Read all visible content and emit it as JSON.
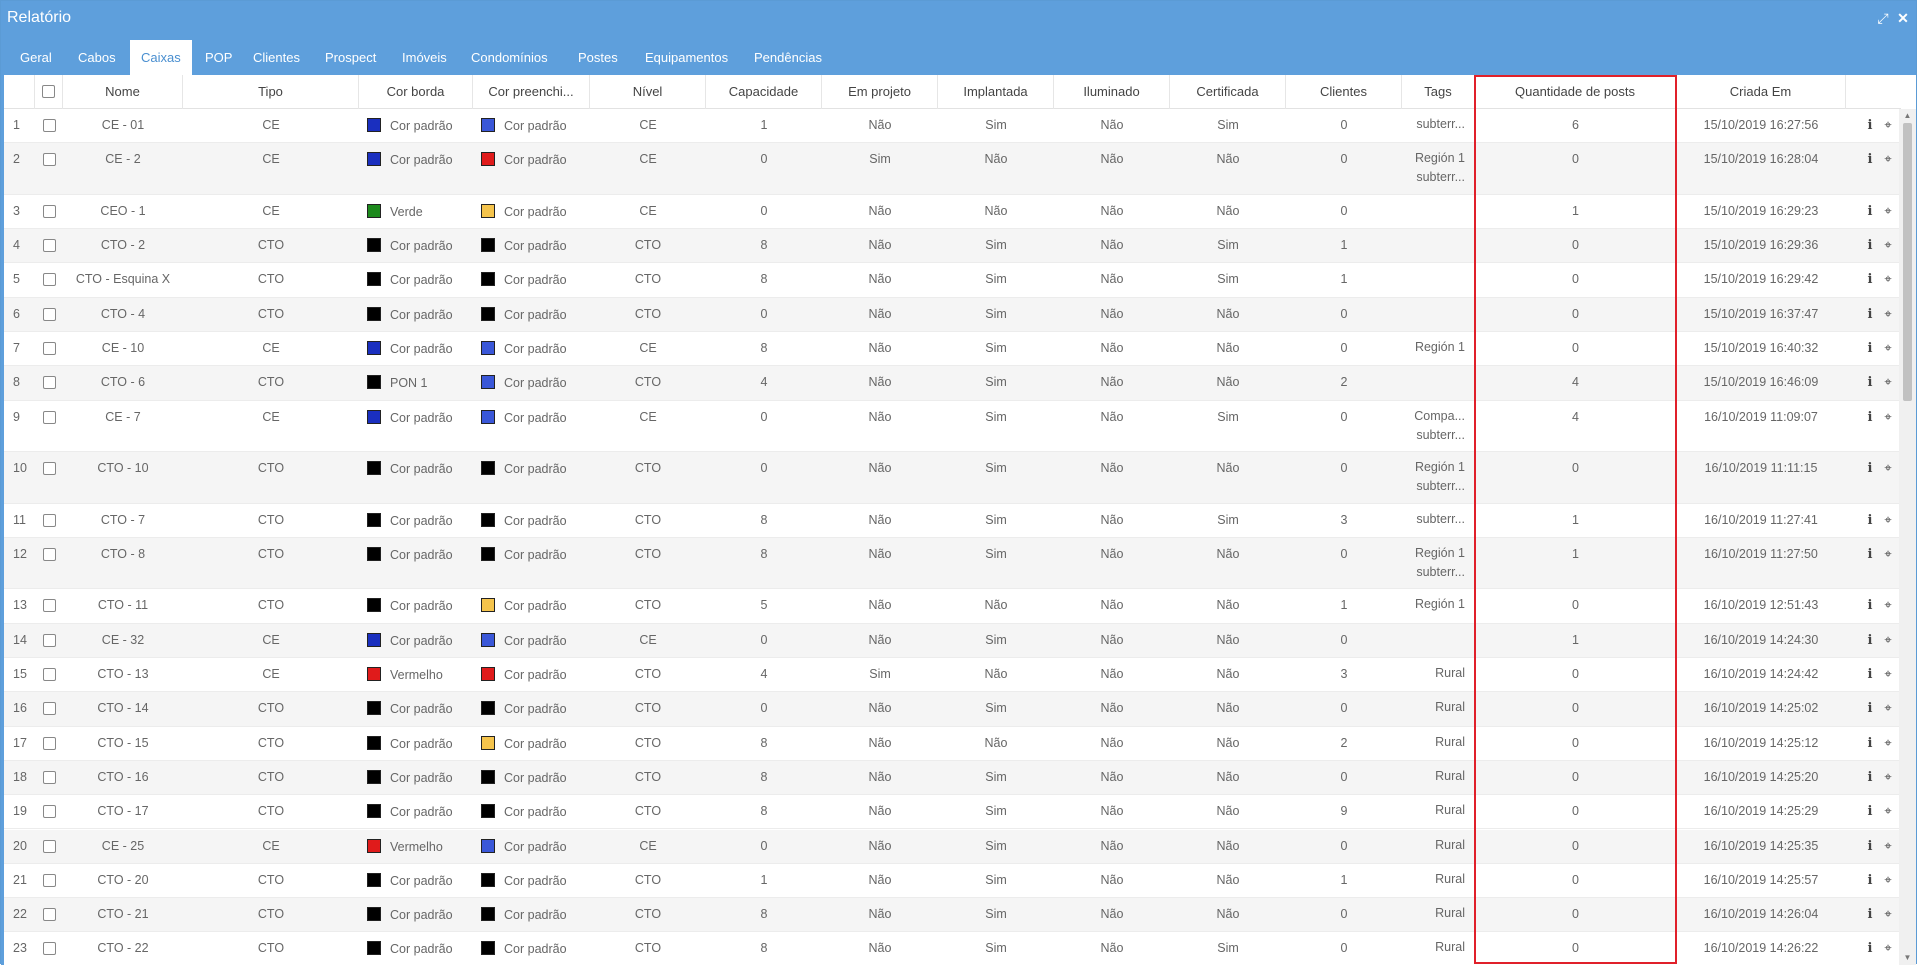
{
  "window": {
    "title": "Relatório",
    "minimize_icon": "compress-icon",
    "close_icon": "close-icon"
  },
  "tabs": [
    {
      "label": "Geral",
      "active": false
    },
    {
      "label": "Cabos",
      "active": false
    },
    {
      "label": "Caixas",
      "active": true
    },
    {
      "label": "POP",
      "active": false
    },
    {
      "label": "Clientes",
      "active": false
    },
    {
      "label": "Prospect",
      "active": false
    },
    {
      "label": "Imóveis",
      "active": false
    },
    {
      "label": "Condomínios",
      "active": false
    },
    {
      "label": "Postes",
      "active": false
    },
    {
      "label": "Equipamentos",
      "active": false
    },
    {
      "label": "Pendências",
      "active": false
    }
  ],
  "columns": [
    "Nome",
    "Tipo",
    "Cor borda",
    "Cor preenchi...",
    "Nível",
    "Capacidade",
    "Em projeto",
    "Implantada",
    "Iluminado",
    "Certificada",
    "Clientes",
    "Tags",
    "Quantidade de posts",
    "Criada Em"
  ],
  "colors": {
    "azul": "#1a2fbf",
    "azul_claro": "#3a57d8",
    "vermelho": "#e01b1b",
    "preto": "#000000",
    "verde": "#1d8a1d",
    "amarelo": "#f5c44c",
    "highlight": "#e0202a",
    "header": "#5e9fdc"
  },
  "rows": [
    {
      "n": "1",
      "nome": "CE - 01",
      "tipo": "CE",
      "borda": "Cor padrão",
      "borda_cor": "#1a2fbf",
      "preench": "Cor padrão",
      "preench_cor": "#3a57d8",
      "nivel": "CE",
      "cap": "1",
      "proj": "Não",
      "impl": "Sim",
      "ilum": "Não",
      "cert": "Sim",
      "cli": "0",
      "tags": [
        "subterr..."
      ],
      "posts": "6",
      "criada": "15/10/2019 16:27:56"
    },
    {
      "n": "2",
      "nome": "CE - 2",
      "tipo": "CE",
      "borda": "Cor padrão",
      "borda_cor": "#1a2fbf",
      "preench": "Cor padrão",
      "preench_cor": "#e01b1b",
      "nivel": "CE",
      "cap": "0",
      "proj": "Sim",
      "impl": "Não",
      "ilum": "Não",
      "cert": "Não",
      "cli": "0",
      "tags": [
        "Región 1",
        "subterr..."
      ],
      "posts": "0",
      "criada": "15/10/2019 16:28:04"
    },
    {
      "n": "3",
      "nome": "CEO - 1",
      "tipo": "CE",
      "borda": "Verde",
      "borda_cor": "#1d8a1d",
      "preench": "Cor padrão",
      "preench_cor": "#f5c44c",
      "nivel": "CE",
      "cap": "0",
      "proj": "Não",
      "impl": "Não",
      "ilum": "Não",
      "cert": "Não",
      "cli": "0",
      "tags": [],
      "posts": "1",
      "criada": "15/10/2019 16:29:23"
    },
    {
      "n": "4",
      "nome": "CTO - 2",
      "tipo": "CTO",
      "borda": "Cor padrão",
      "borda_cor": "#000000",
      "preench": "Cor padrão",
      "preench_cor": "#000000",
      "nivel": "CTO",
      "cap": "8",
      "proj": "Não",
      "impl": "Sim",
      "ilum": "Não",
      "cert": "Sim",
      "cli": "1",
      "tags": [],
      "posts": "0",
      "criada": "15/10/2019 16:29:36"
    },
    {
      "n": "5",
      "nome": "CTO - Esquina X",
      "tipo": "CTO",
      "borda": "Cor padrão",
      "borda_cor": "#000000",
      "preench": "Cor padrão",
      "preench_cor": "#000000",
      "nivel": "CTO",
      "cap": "8",
      "proj": "Não",
      "impl": "Sim",
      "ilum": "Não",
      "cert": "Sim",
      "cli": "1",
      "tags": [],
      "posts": "0",
      "criada": "15/10/2019 16:29:42"
    },
    {
      "n": "6",
      "nome": "CTO - 4",
      "tipo": "CTO",
      "borda": "Cor padrão",
      "borda_cor": "#000000",
      "preench": "Cor padrão",
      "preench_cor": "#000000",
      "nivel": "CTO",
      "cap": "0",
      "proj": "Não",
      "impl": "Sim",
      "ilum": "Não",
      "cert": "Não",
      "cli": "0",
      "tags": [],
      "posts": "0",
      "criada": "15/10/2019 16:37:47"
    },
    {
      "n": "7",
      "nome": "CE - 10",
      "tipo": "CE",
      "borda": "Cor padrão",
      "borda_cor": "#1a2fbf",
      "preench": "Cor padrão",
      "preench_cor": "#3a57d8",
      "nivel": "CE",
      "cap": "8",
      "proj": "Não",
      "impl": "Sim",
      "ilum": "Não",
      "cert": "Não",
      "cli": "0",
      "tags": [
        "Región 1"
      ],
      "posts": "0",
      "criada": "15/10/2019 16:40:32"
    },
    {
      "n": "8",
      "nome": "CTO - 6",
      "tipo": "CTO",
      "borda": "PON 1",
      "borda_cor": "#000000",
      "preench": "Cor padrão",
      "preench_cor": "#3a57d8",
      "nivel": "CTO",
      "cap": "4",
      "proj": "Não",
      "impl": "Sim",
      "ilum": "Não",
      "cert": "Não",
      "cli": "2",
      "tags": [],
      "posts": "4",
      "criada": "15/10/2019 16:46:09"
    },
    {
      "n": "9",
      "nome": "CE - 7",
      "tipo": "CE",
      "borda": "Cor padrão",
      "borda_cor": "#1a2fbf",
      "preench": "Cor padrão",
      "preench_cor": "#3a57d8",
      "nivel": "CE",
      "cap": "0",
      "proj": "Não",
      "impl": "Sim",
      "ilum": "Não",
      "cert": "Sim",
      "cli": "0",
      "tags": [
        "Compa...",
        "subterr..."
      ],
      "posts": "4",
      "criada": "16/10/2019 11:09:07"
    },
    {
      "n": "10",
      "nome": "CTO - 10",
      "tipo": "CTO",
      "borda": "Cor padrão",
      "borda_cor": "#000000",
      "preench": "Cor padrão",
      "preench_cor": "#000000",
      "nivel": "CTO",
      "cap": "0",
      "proj": "Não",
      "impl": "Sim",
      "ilum": "Não",
      "cert": "Não",
      "cli": "0",
      "tags": [
        "Región 1",
        "subterr..."
      ],
      "posts": "0",
      "criada": "16/10/2019 11:11:15"
    },
    {
      "n": "11",
      "nome": "CTO - 7",
      "tipo": "CTO",
      "borda": "Cor padrão",
      "borda_cor": "#000000",
      "preench": "Cor padrão",
      "preench_cor": "#000000",
      "nivel": "CTO",
      "cap": "8",
      "proj": "Não",
      "impl": "Sim",
      "ilum": "Não",
      "cert": "Sim",
      "cli": "3",
      "tags": [
        "subterr..."
      ],
      "posts": "1",
      "criada": "16/10/2019 11:27:41"
    },
    {
      "n": "12",
      "nome": "CTO - 8",
      "tipo": "CTO",
      "borda": "Cor padrão",
      "borda_cor": "#000000",
      "preench": "Cor padrão",
      "preench_cor": "#000000",
      "nivel": "CTO",
      "cap": "8",
      "proj": "Não",
      "impl": "Sim",
      "ilum": "Não",
      "cert": "Não",
      "cli": "0",
      "tags": [
        "Región 1",
        "subterr..."
      ],
      "posts": "1",
      "criada": "16/10/2019 11:27:50"
    },
    {
      "n": "13",
      "nome": "CTO - 11",
      "tipo": "CTO",
      "borda": "Cor padrão",
      "borda_cor": "#000000",
      "preench": "Cor padrão",
      "preench_cor": "#f5c44c",
      "nivel": "CTO",
      "cap": "5",
      "proj": "Não",
      "impl": "Não",
      "ilum": "Não",
      "cert": "Não",
      "cli": "1",
      "tags": [
        "Región 1"
      ],
      "posts": "0",
      "criada": "16/10/2019 12:51:43"
    },
    {
      "n": "14",
      "nome": "CE - 32",
      "tipo": "CE",
      "borda": "Cor padrão",
      "borda_cor": "#1a2fbf",
      "preench": "Cor padrão",
      "preench_cor": "#3a57d8",
      "nivel": "CE",
      "cap": "0",
      "proj": "Não",
      "impl": "Sim",
      "ilum": "Não",
      "cert": "Não",
      "cli": "0",
      "tags": [],
      "posts": "1",
      "criada": "16/10/2019 14:24:30"
    },
    {
      "n": "15",
      "nome": "CTO - 13",
      "tipo": "CE",
      "borda": "Vermelho",
      "borda_cor": "#e01b1b",
      "preench": "Cor padrão",
      "preench_cor": "#e01b1b",
      "nivel": "CTO",
      "cap": "4",
      "proj": "Sim",
      "impl": "Não",
      "ilum": "Não",
      "cert": "Não",
      "cli": "3",
      "tags": [
        "Rural"
      ],
      "posts": "0",
      "criada": "16/10/2019 14:24:42"
    },
    {
      "n": "16",
      "nome": "CTO - 14",
      "tipo": "CTO",
      "borda": "Cor padrão",
      "borda_cor": "#000000",
      "preench": "Cor padrão",
      "preench_cor": "#000000",
      "nivel": "CTO",
      "cap": "0",
      "proj": "Não",
      "impl": "Sim",
      "ilum": "Não",
      "cert": "Não",
      "cli": "0",
      "tags": [
        "Rural"
      ],
      "posts": "0",
      "criada": "16/10/2019 14:25:02"
    },
    {
      "n": "17",
      "nome": "CTO - 15",
      "tipo": "CTO",
      "borda": "Cor padrão",
      "borda_cor": "#000000",
      "preench": "Cor padrão",
      "preench_cor": "#f5c44c",
      "nivel": "CTO",
      "cap": "8",
      "proj": "Não",
      "impl": "Não",
      "ilum": "Não",
      "cert": "Não",
      "cli": "2",
      "tags": [
        "Rural"
      ],
      "posts": "0",
      "criada": "16/10/2019 14:25:12"
    },
    {
      "n": "18",
      "nome": "CTO - 16",
      "tipo": "CTO",
      "borda": "Cor padrão",
      "borda_cor": "#000000",
      "preench": "Cor padrão",
      "preench_cor": "#000000",
      "nivel": "CTO",
      "cap": "8",
      "proj": "Não",
      "impl": "Sim",
      "ilum": "Não",
      "cert": "Não",
      "cli": "0",
      "tags": [
        "Rural"
      ],
      "posts": "0",
      "criada": "16/10/2019 14:25:20"
    },
    {
      "n": "19",
      "nome": "CTO - 17",
      "tipo": "CTO",
      "borda": "Cor padrão",
      "borda_cor": "#000000",
      "preench": "Cor padrão",
      "preench_cor": "#000000",
      "nivel": "CTO",
      "cap": "8",
      "proj": "Não",
      "impl": "Sim",
      "ilum": "Não",
      "cert": "Não",
      "cli": "9",
      "tags": [
        "Rural"
      ],
      "posts": "0",
      "criada": "16/10/2019 14:25:29"
    },
    {
      "n": "20",
      "nome": "CE - 25",
      "tipo": "CE",
      "borda": "Vermelho",
      "borda_cor": "#e01b1b",
      "preench": "Cor padrão",
      "preench_cor": "#3a57d8",
      "nivel": "CE",
      "cap": "0",
      "proj": "Não",
      "impl": "Sim",
      "ilum": "Não",
      "cert": "Não",
      "cli": "0",
      "tags": [
        "Rural"
      ],
      "posts": "0",
      "criada": "16/10/2019 14:25:35"
    },
    {
      "n": "21",
      "nome": "CTO - 20",
      "tipo": "CTO",
      "borda": "Cor padrão",
      "borda_cor": "#000000",
      "preench": "Cor padrão",
      "preench_cor": "#000000",
      "nivel": "CTO",
      "cap": "1",
      "proj": "Não",
      "impl": "Sim",
      "ilum": "Não",
      "cert": "Não",
      "cli": "1",
      "tags": [
        "Rural"
      ],
      "posts": "0",
      "criada": "16/10/2019 14:25:57"
    },
    {
      "n": "22",
      "nome": "CTO - 21",
      "tipo": "CTO",
      "borda": "Cor padrão",
      "borda_cor": "#000000",
      "preench": "Cor padrão",
      "preench_cor": "#000000",
      "nivel": "CTO",
      "cap": "8",
      "proj": "Não",
      "impl": "Sim",
      "ilum": "Não",
      "cert": "Não",
      "cli": "0",
      "tags": [
        "Rural"
      ],
      "posts": "0",
      "criada": "16/10/2019 14:26:04"
    },
    {
      "n": "23",
      "nome": "CTO - 22",
      "tipo": "CTO",
      "borda": "Cor padrão",
      "borda_cor": "#000000",
      "preench": "Cor padrão",
      "preench_cor": "#000000",
      "nivel": "CTO",
      "cap": "8",
      "proj": "Não",
      "impl": "Sim",
      "ilum": "Não",
      "cert": "Sim",
      "cli": "0",
      "tags": [
        "Rural"
      ],
      "posts": "0",
      "criada": "16/10/2019 14:26:22"
    }
  ]
}
